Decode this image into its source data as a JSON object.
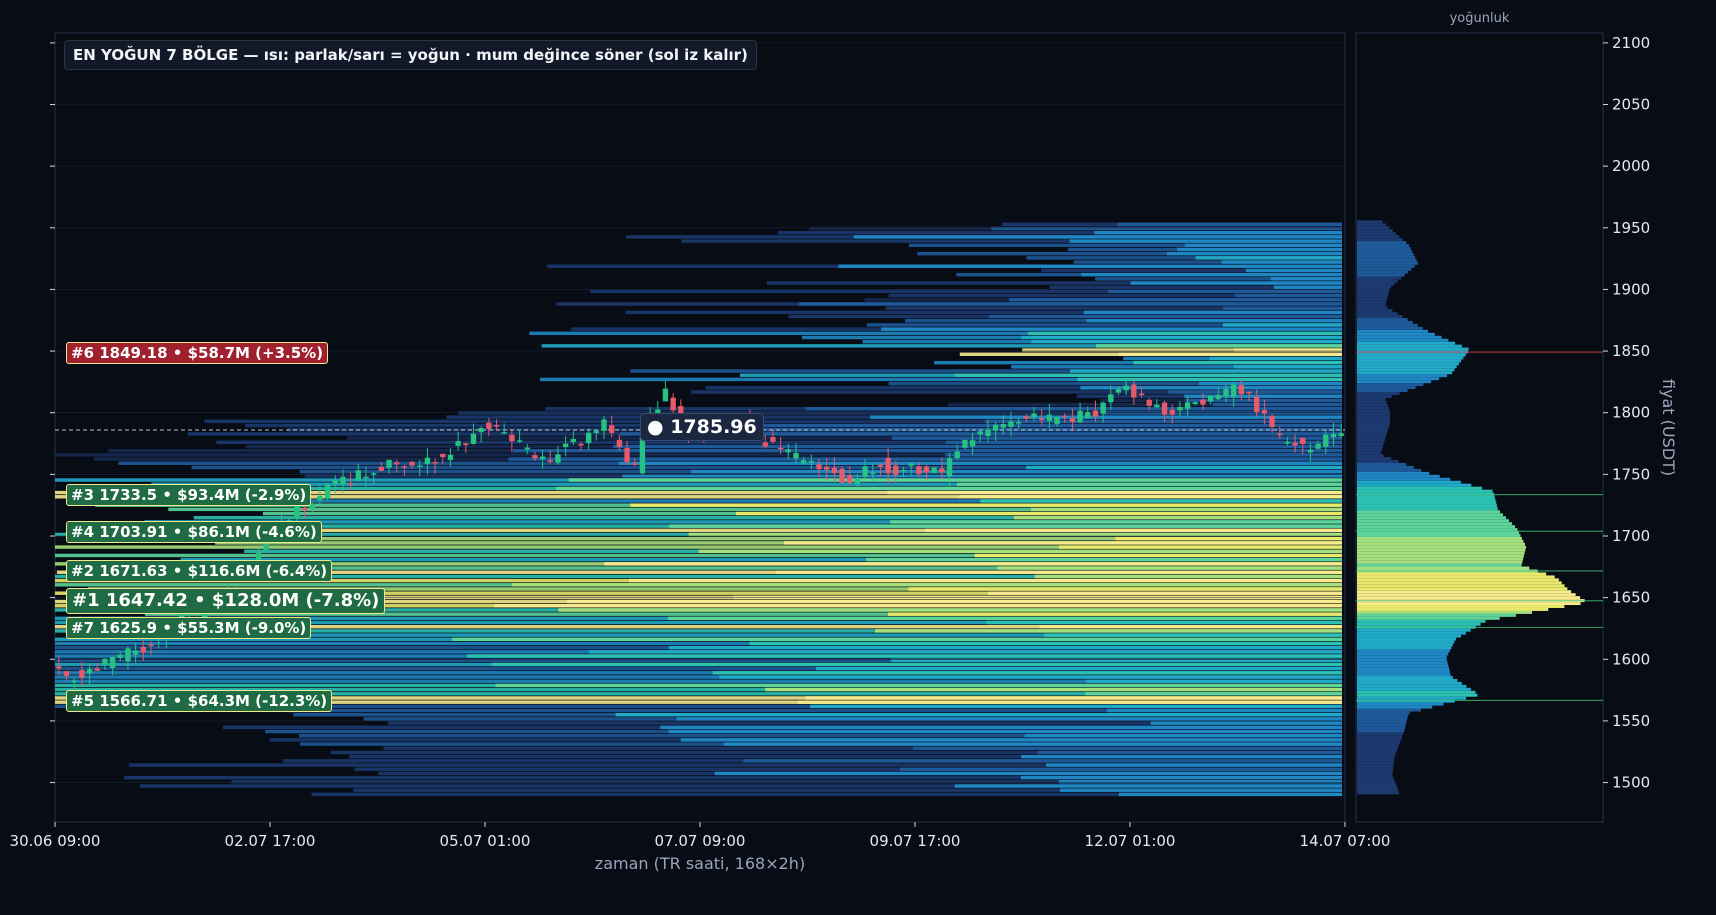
{
  "title": "EN YOĞUN 7 BÖLGE — ısı: parlak/sarı = yoğun · mum değince söner (sol iz kalır)",
  "current_price_label": "● 1785.96",
  "profile_title": "yoğunluk",
  "colors": {
    "up": "#26c281",
    "down": "#e8596a",
    "background": "#080c14",
    "highlight": "#f4e55a",
    "zone_up": "#1f6b43",
    "zone_down": "#a0202e"
  },
  "chart_data": {
    "type": "candlestick-heatmap",
    "title": "EN YOĞUN 7 BÖLGE — ısı: parlak/sarı = yoğun · mum değince söner (sol iz kalır)",
    "xlabel": "zaman (TR saati, 168×2h)",
    "ylabel": "fiyat (USDT)",
    "ylim": [
      1468,
      2108
    ],
    "yticks": [
      1500,
      1550,
      1600,
      1650,
      1700,
      1750,
      1800,
      1850,
      1900,
      1950,
      2000,
      2050,
      2100
    ],
    "xlim": [
      0,
      168
    ],
    "xticks": [
      {
        "pos": 0,
        "label": "30.06 09:00"
      },
      {
        "pos": 28,
        "label": "02.07 17:00"
      },
      {
        "pos": 56,
        "label": "05.07 01:00"
      },
      {
        "pos": 84,
        "label": "07.07 09:00"
      },
      {
        "pos": 112,
        "label": "09.07 17:00"
      },
      {
        "pos": 140,
        "label": "12.07 01:00"
      },
      {
        "pos": 168,
        "label": "14.07 07:00"
      }
    ],
    "current_price": 1785.96,
    "price_path": [
      [
        0,
        1590
      ],
      [
        4,
        1585
      ],
      [
        8,
        1600
      ],
      [
        12,
        1610
      ],
      [
        16,
        1630
      ],
      [
        20,
        1640
      ],
      [
        24,
        1660
      ],
      [
        28,
        1695
      ],
      [
        32,
        1720
      ],
      [
        36,
        1740
      ],
      [
        40,
        1750
      ],
      [
        44,
        1760
      ],
      [
        48,
        1755
      ],
      [
        52,
        1770
      ],
      [
        54,
        1775
      ],
      [
        56,
        1790
      ],
      [
        60,
        1780
      ],
      [
        62,
        1770
      ],
      [
        64,
        1760
      ],
      [
        68,
        1775
      ],
      [
        72,
        1790
      ],
      [
        75,
        1760
      ],
      [
        76,
        1755
      ],
      [
        78,
        1800
      ],
      [
        80,
        1815
      ],
      [
        82,
        1790
      ],
      [
        86,
        1780
      ],
      [
        90,
        1790
      ],
      [
        92,
        1780
      ],
      [
        95,
        1770
      ],
      [
        98,
        1760
      ],
      [
        102,
        1750
      ],
      [
        104,
        1745
      ],
      [
        108,
        1760
      ],
      [
        110,
        1750
      ],
      [
        112,
        1755
      ],
      [
        116,
        1750
      ],
      [
        118,
        1770
      ],
      [
        120,
        1780
      ],
      [
        124,
        1790
      ],
      [
        128,
        1795
      ],
      [
        132,
        1795
      ],
      [
        136,
        1800
      ],
      [
        138,
        1815
      ],
      [
        140,
        1818
      ],
      [
        142,
        1810
      ],
      [
        146,
        1800
      ],
      [
        150,
        1810
      ],
      [
        154,
        1820
      ],
      [
        156,
        1815
      ],
      [
        158,
        1795
      ],
      [
        160,
        1780
      ],
      [
        162,
        1775
      ],
      [
        164,
        1770
      ],
      [
        166,
        1780
      ],
      [
        168,
        1786
      ]
    ],
    "zones": [
      {
        "rank": 6,
        "label": "#6  1849.18  •  $58.7M  (+3.5%)",
        "price": 1849.18,
        "direction": "up_from_current"
      },
      {
        "rank": 3,
        "label": "#3  1733.5  •  $93.4M  (-2.9%)",
        "price": 1733.5,
        "direction": "below"
      },
      {
        "rank": 4,
        "label": "#4  1703.91  •  $86.1M  (-4.6%)",
        "price": 1703.91,
        "direction": "below"
      },
      {
        "rank": 2,
        "label": "#2  1671.63  •  $116.6M  (-6.4%)",
        "price": 1671.63,
        "direction": "below"
      },
      {
        "rank": 1,
        "label": "#1  1647.42  •  $128.0M  (-7.8%)",
        "price": 1647.42,
        "direction": "below"
      },
      {
        "rank": 7,
        "label": "#7  1625.9  •  $55.3M  (-9.0%)",
        "price": 1625.9,
        "direction": "below"
      },
      {
        "rank": 5,
        "label": "#5  1566.71  •  $64.3M  (-12.3%)",
        "price": 1566.71,
        "direction": "below"
      }
    ],
    "profile_peaks": [
      [
        1490,
        0.18
      ],
      [
        1505,
        0.15
      ],
      [
        1520,
        0.16
      ],
      [
        1540,
        0.2
      ],
      [
        1555,
        0.22
      ],
      [
        1570,
        0.52
      ],
      [
        1585,
        0.4
      ],
      [
        1600,
        0.38
      ],
      [
        1615,
        0.42
      ],
      [
        1630,
        0.55
      ],
      [
        1645,
        0.98
      ],
      [
        1655,
        0.9
      ],
      [
        1665,
        0.85
      ],
      [
        1675,
        0.7
      ],
      [
        1690,
        0.72
      ],
      [
        1705,
        0.68
      ],
      [
        1720,
        0.6
      ],
      [
        1735,
        0.58
      ],
      [
        1750,
        0.3
      ],
      [
        1765,
        0.1
      ],
      [
        1790,
        0.14
      ],
      [
        1800,
        0.14
      ],
      [
        1810,
        0.12
      ],
      [
        1830,
        0.4
      ],
      [
        1850,
        0.48
      ],
      [
        1865,
        0.3
      ],
      [
        1885,
        0.12
      ],
      [
        1900,
        0.14
      ],
      [
        1920,
        0.26
      ],
      [
        1935,
        0.22
      ],
      [
        1955,
        0.1
      ]
    ]
  }
}
